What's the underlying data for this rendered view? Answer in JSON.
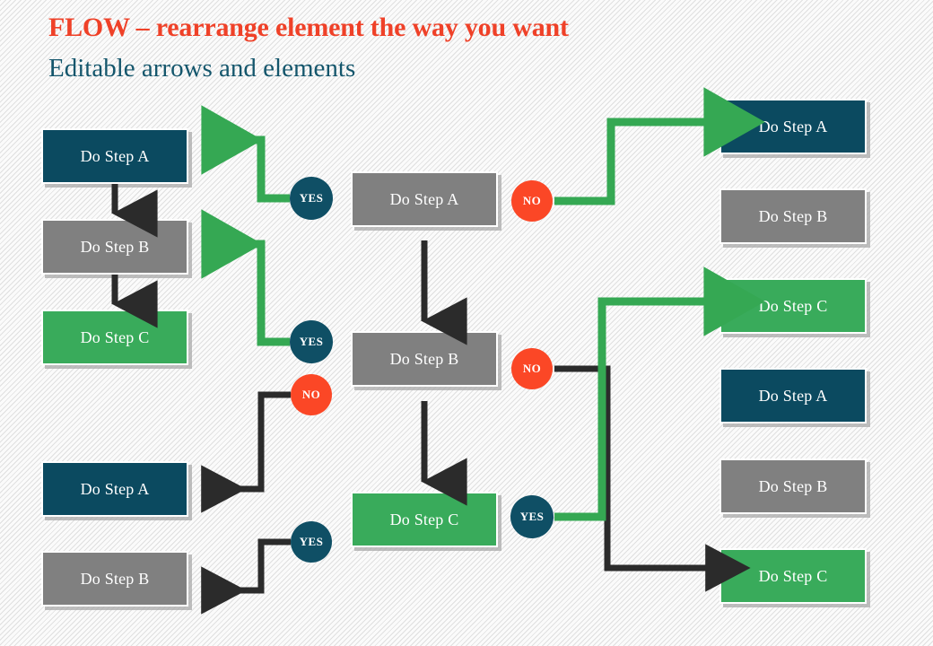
{
  "slide": {
    "title_main": "FLOW – rearrange element the way you want",
    "title_sub": "Editable arrows and elements",
    "colors": {
      "title_main": "#ef4128",
      "title_sub": "#14566c",
      "navy": "#0b4a60",
      "gray": "#808080",
      "green": "#39ab5b",
      "yes_badge": "#0f4f65",
      "no_badge": "#fb4726",
      "green_arrow": "#35a853",
      "dark_arrow": "#2b2b2b",
      "background": "#fbfbfb"
    }
  },
  "left_column": {
    "boxes": [
      {
        "label": "Do Step A",
        "style": "navy"
      },
      {
        "label": "Do Step B",
        "style": "gray"
      },
      {
        "label": "Do Step C",
        "style": "green"
      },
      {
        "label": "Do Step A",
        "style": "navy"
      },
      {
        "label": "Do Step B",
        "style": "gray"
      }
    ]
  },
  "center_column": {
    "boxes": [
      {
        "label": "Do Step A",
        "style": "gray"
      },
      {
        "label": "Do Step B",
        "style": "gray"
      },
      {
        "label": "Do Step C",
        "style": "green"
      }
    ]
  },
  "right_column": {
    "boxes": [
      {
        "label": "Do Step A",
        "style": "navy"
      },
      {
        "label": "Do Step B",
        "style": "gray"
      },
      {
        "label": "Do Step C",
        "style": "green"
      },
      {
        "label": "Do Step A",
        "style": "navy"
      },
      {
        "label": "Do Step B",
        "style": "gray"
      },
      {
        "label": "Do Step C",
        "style": "green"
      }
    ]
  },
  "badges": {
    "yes_top": "YES",
    "yes_mid": "YES",
    "no_left": "NO",
    "yes_bottom_left": "YES",
    "no_center_top": "NO",
    "no_center_mid": "NO",
    "yes_center_bottom": "YES"
  }
}
